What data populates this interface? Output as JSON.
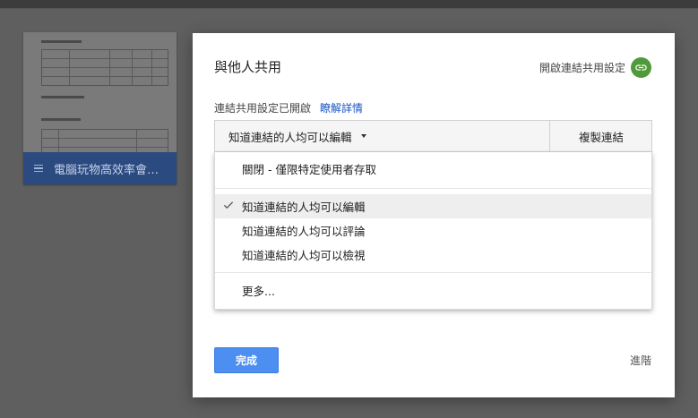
{
  "background": {
    "doc_title": "電腦玩物高效率會議..."
  },
  "dialog": {
    "title": "與他人共用",
    "link_sharing_label": "開啟連結共用設定",
    "status_text": "連結共用設定已開啟",
    "learn_more": "瞭解詳情",
    "access_select": {
      "current_value": "知道連結的人均可以編輯",
      "copy_link_label": "複製連結"
    },
    "menu": {
      "items": [
        {
          "label": "關閉 - 僅限特定使用者存取"
        },
        {
          "label": "知道連結的人均可以編輯",
          "selected": true
        },
        {
          "label": "知道連結的人均可以評論"
        },
        {
          "label": "知道連結的人均可以檢視"
        },
        {
          "label": "更多..."
        }
      ]
    },
    "done_label": "完成",
    "advanced_label": "進階"
  },
  "colors": {
    "accent_blue": "#4d8ff0",
    "link_icon_green": "#4f9a3a",
    "link_text_blue": "#1a56c4"
  }
}
